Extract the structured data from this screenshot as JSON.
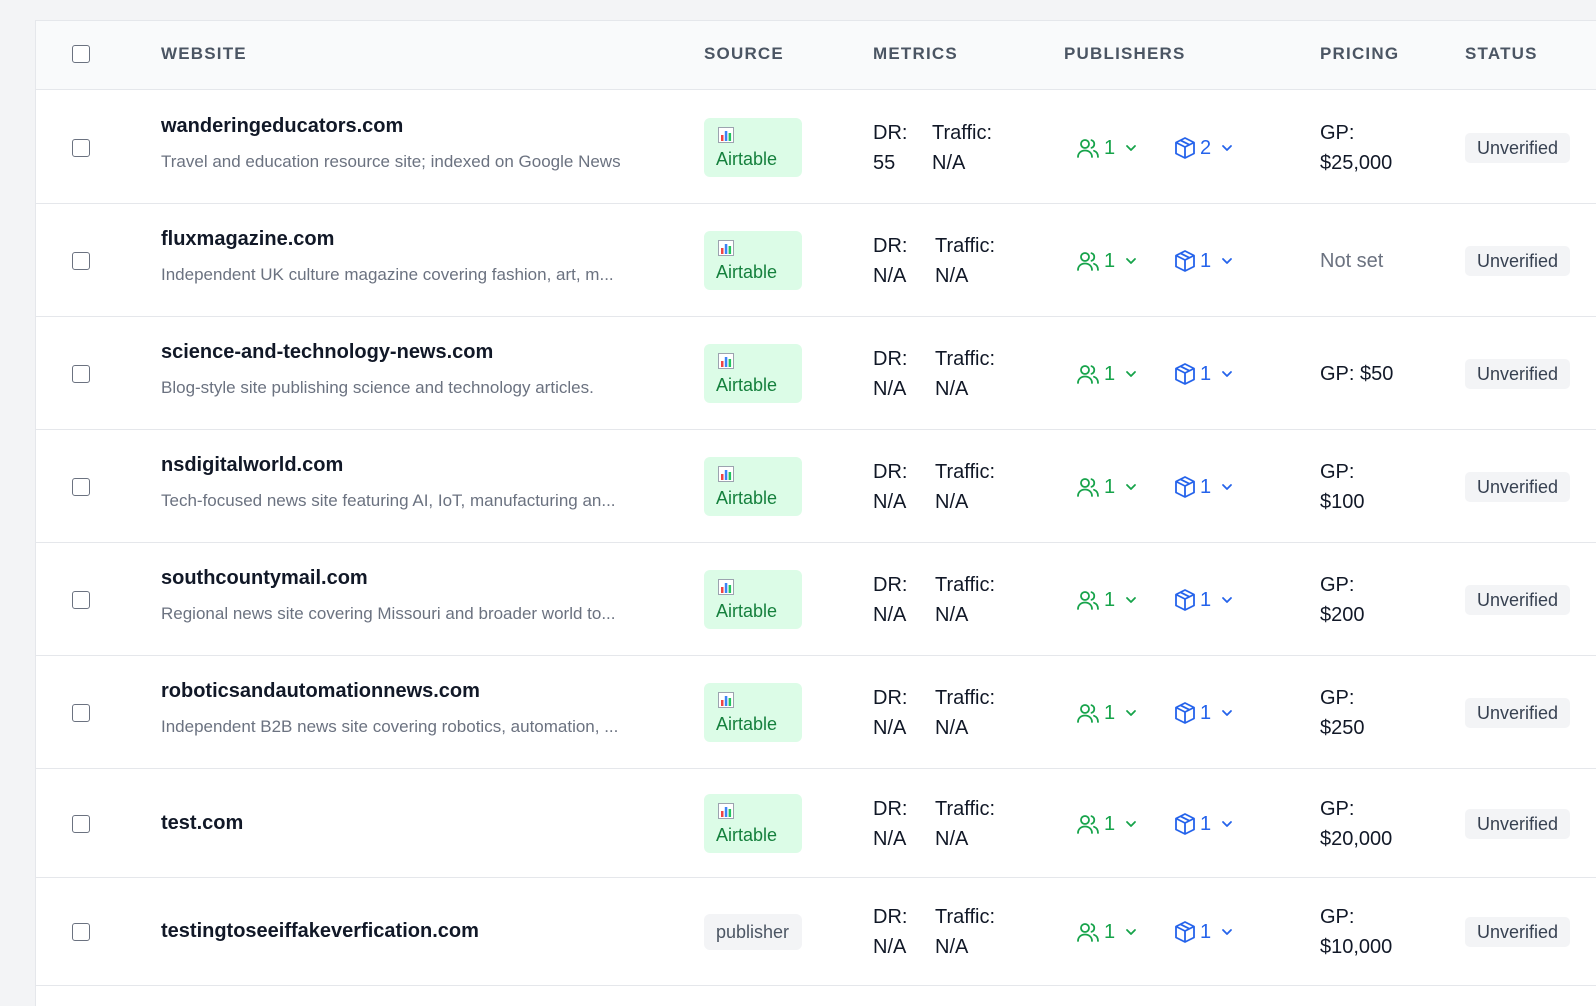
{
  "columns": {
    "website": "WEBSITE",
    "source": "SOURCE",
    "metrics": "METRICS",
    "publishers": "PUBLISHERS",
    "pricing": "PRICING",
    "status": "STATUS"
  },
  "metric_labels": {
    "dr": "DR:",
    "traffic": "Traffic:"
  },
  "colors": {
    "airtable_bg": "#dcfce7",
    "airtable_fg": "#15803d",
    "publisher_green": "#16a34a",
    "offering_blue": "#2563eb"
  },
  "rows": [
    {
      "name": "wanderingeducators.com",
      "desc": "Travel and education resource site; indexed on Google News",
      "source": "Airtable",
      "source_icon": "bar-chart-icon",
      "dr": "55",
      "traffic": "N/A",
      "publishers": "1",
      "offerings": "2",
      "pricing_label": "GP:",
      "pricing_value": "$25,000",
      "status": "Unverified"
    },
    {
      "name": "fluxmagazine.com",
      "desc": "Independent UK culture magazine covering fashion, art, m...",
      "source": "Airtable",
      "source_icon": "bar-chart-icon",
      "dr": "N/A",
      "traffic": "N/A",
      "publishers": "1",
      "offerings": "1",
      "pricing_label": "Not set",
      "pricing_value": "",
      "status": "Unverified"
    },
    {
      "name": "science-and-technology-news.com",
      "desc": "Blog-style site publishing science and technology articles.",
      "source": "Airtable",
      "source_icon": "bar-chart-icon",
      "dr": "N/A",
      "traffic": "N/A",
      "publishers": "1",
      "offerings": "1",
      "pricing_label": "GP: $50",
      "pricing_value": "",
      "status": "Unverified"
    },
    {
      "name": "nsdigitalworld.com",
      "desc": "Tech-focused news site featuring AI, IoT, manufacturing an...",
      "source": "Airtable",
      "source_icon": "bar-chart-icon",
      "dr": "N/A",
      "traffic": "N/A",
      "publishers": "1",
      "offerings": "1",
      "pricing_label": "GP:",
      "pricing_value": "$100",
      "status": "Unverified"
    },
    {
      "name": "southcountymail.com",
      "desc": "Regional news site covering Missouri and broader world to...",
      "source": "Airtable",
      "source_icon": "bar-chart-icon",
      "dr": "N/A",
      "traffic": "N/A",
      "publishers": "1",
      "offerings": "1",
      "pricing_label": "GP:",
      "pricing_value": "$200",
      "status": "Unverified"
    },
    {
      "name": "roboticsandautomationnews.com",
      "desc": "Independent B2B news site covering robotics, automation, ...",
      "source": "Airtable",
      "source_icon": "bar-chart-icon",
      "dr": "N/A",
      "traffic": "N/A",
      "publishers": "1",
      "offerings": "1",
      "pricing_label": "GP:",
      "pricing_value": "$250",
      "status": "Unverified"
    },
    {
      "name": "test.com",
      "desc": "",
      "source": "Airtable",
      "source_icon": "bar-chart-icon",
      "dr": "N/A",
      "traffic": "N/A",
      "publishers": "1",
      "offerings": "1",
      "pricing_label": "GP:",
      "pricing_value": "$20,000",
      "status": "Unverified"
    },
    {
      "name": "testingtoseeiffakeverfication.com",
      "desc": "",
      "source": "publisher",
      "source_icon": "",
      "dr": "N/A",
      "traffic": "N/A",
      "publishers": "1",
      "offerings": "1",
      "pricing_label": "GP:",
      "pricing_value": "$10,000",
      "status": "Unverified"
    }
  ]
}
